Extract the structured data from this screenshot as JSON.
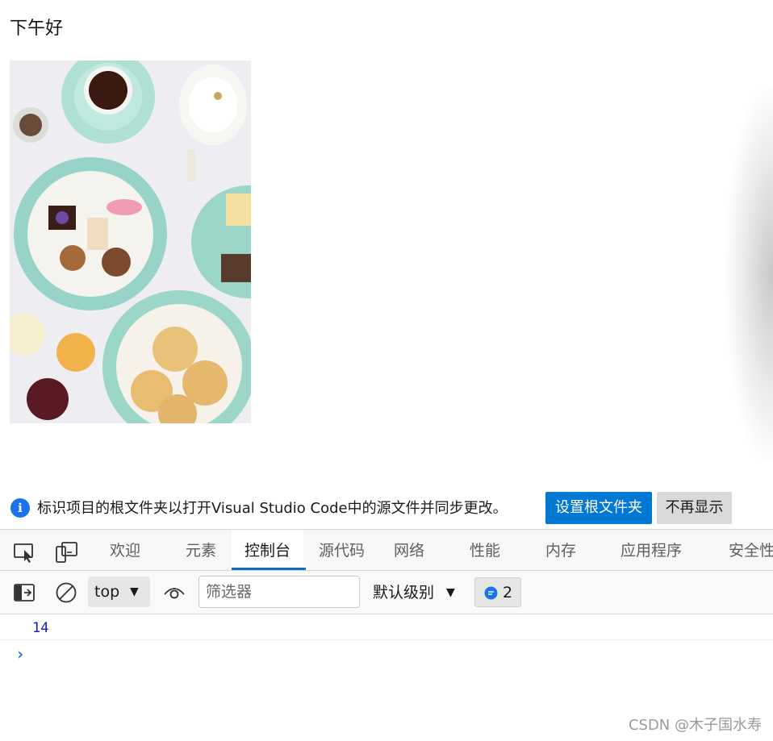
{
  "page": {
    "heading": "下午好"
  },
  "infobar": {
    "message": "标识项目的根文件夹以打开Visual Studio Code中的源文件并同步更改。",
    "primary_button": "设置根文件夹",
    "secondary_button": "不再显示"
  },
  "devtools": {
    "tabs": [
      {
        "label": "欢迎"
      },
      {
        "label": "元素"
      },
      {
        "label": "控制台",
        "active": true
      },
      {
        "label": "源代码"
      },
      {
        "label": "网络"
      },
      {
        "label": "性能"
      },
      {
        "label": "内存"
      },
      {
        "label": "应用程序"
      },
      {
        "label": "安全性"
      }
    ],
    "accent_color": "#0f6cbd"
  },
  "console_toolbar": {
    "context": "top",
    "filter_placeholder": "筛选器",
    "levels_label": "默认级别",
    "message_count": "2"
  },
  "console": {
    "output": [
      {
        "value": "14"
      }
    ],
    "prompt": "›"
  },
  "watermark": "CSDN @木子国水寿"
}
